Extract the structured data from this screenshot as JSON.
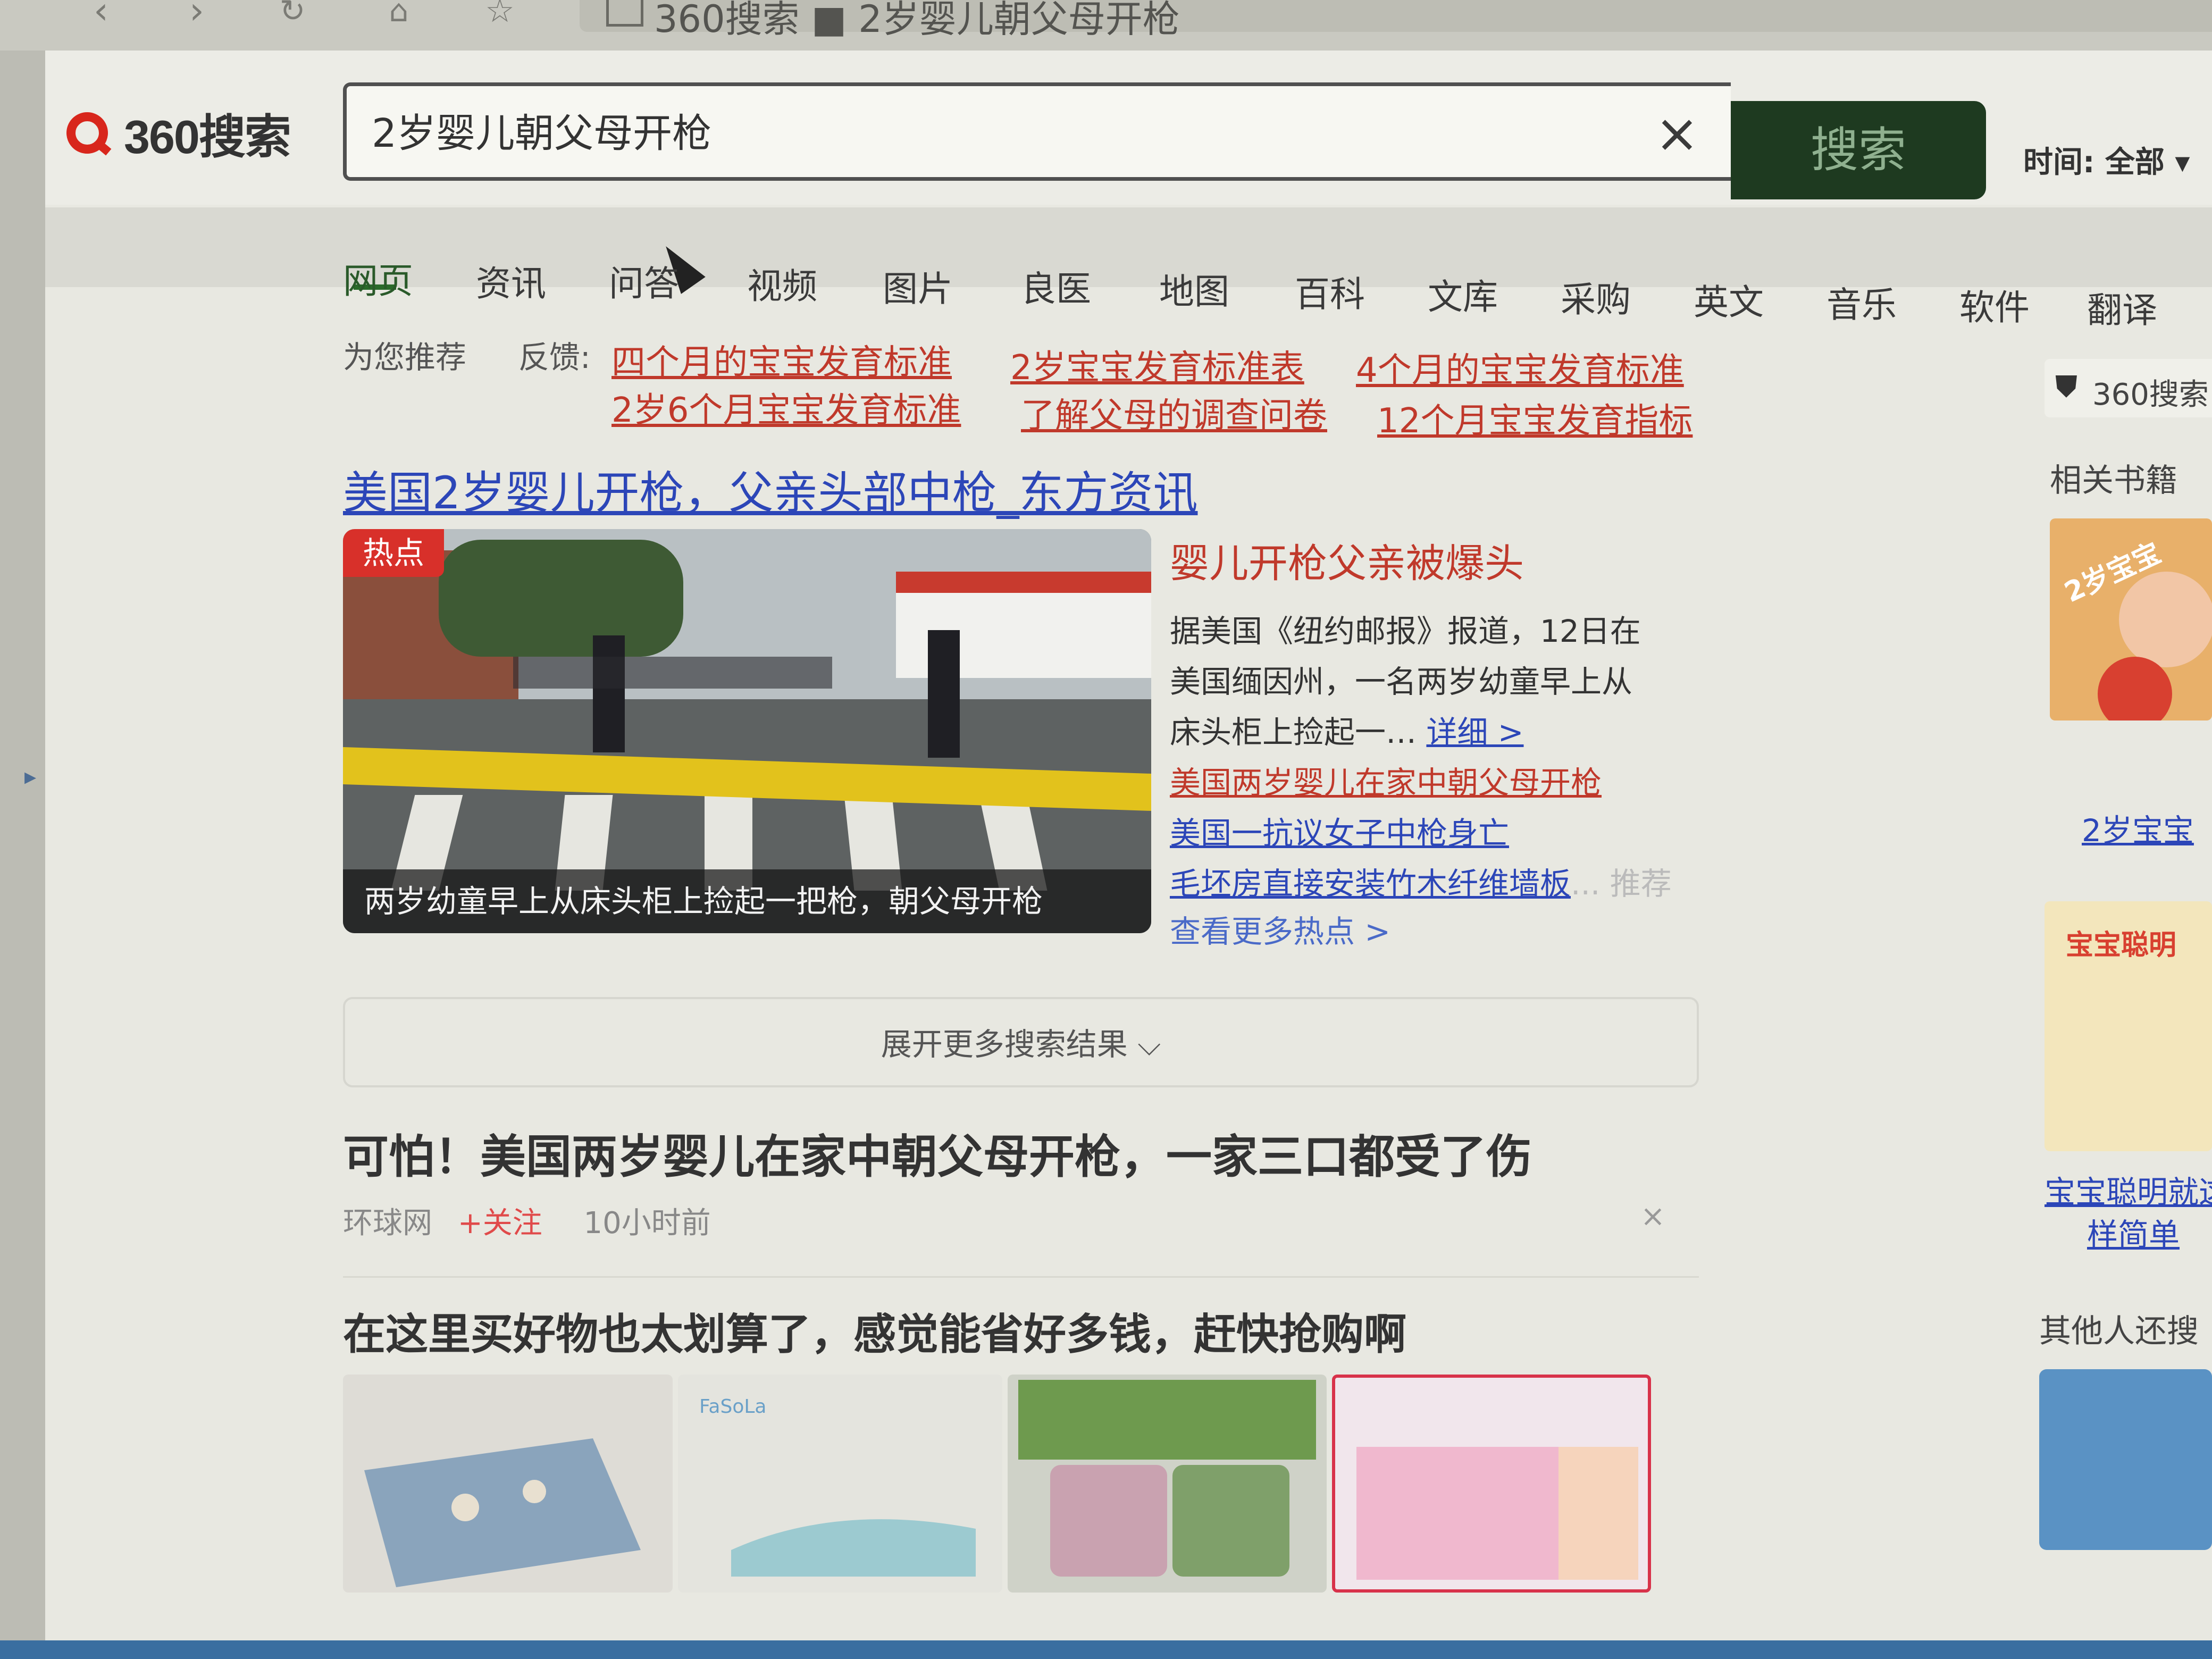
{
  "browser": {
    "tab_title": "360搜索 ■ 2岁婴儿朝父母开枪"
  },
  "header": {
    "logo_text": "360搜索",
    "search_value": "2岁婴儿朝父母开枪",
    "clear_label": "×",
    "search_button": "搜索",
    "time_filter": "时间: 全部 ▾"
  },
  "nav": {
    "tabs": [
      "网页",
      "资讯",
      "问答",
      "视频",
      "图片",
      "良医",
      "地图",
      "百科",
      "文库",
      "采购",
      "英文",
      "音乐",
      "软件",
      "翻译"
    ]
  },
  "recommend": {
    "label": "为您推荐",
    "feedback": "反馈:",
    "links": [
      "四个月的宝宝发育标准",
      "2岁宝宝发育标准表",
      "4个月的宝宝发育标准",
      "2岁6个月宝宝发育标准",
      "了解父母的调查问卷",
      "12个月宝宝发育指标"
    ]
  },
  "result1": {
    "title": "美国2岁婴儿开枪，父亲头部中枪_东方资讯",
    "badge": "热点",
    "caption": "两岁幼童早上从床头柜上捡起一把枪，朝父母开枪",
    "subtitle": "婴儿开枪父亲被爆头",
    "desc_lines": [
      "据美国《纽约邮报》报道，12日在",
      "美国缅因州，一名两岁幼童早上从",
      "床头柜上捡起一…"
    ],
    "detail_link": "详细 >",
    "related": [
      "美国两岁婴儿在家中朝父母开枪",
      "美国一抗议女子中枪身亡",
      "毛坯房直接安装竹木纤维墙板"
    ],
    "promo_tag": "... 推荐",
    "more_hot": "查看更多热点 >"
  },
  "expand_label": "展开更多搜索结果 ⌵",
  "result2": {
    "title": "可怕！美国两岁婴儿在家中朝父母开枪，一家三口都受了伤",
    "source": "环球网",
    "follow": "+关注",
    "time": "10小时前",
    "close": "×"
  },
  "result3": {
    "title": "在这里买好物也太划算了，感觉能省好多钱，赶快抢购啊",
    "product_brand": "FaSoLa"
  },
  "sidebar": {
    "badge": "360搜索",
    "related_books": "相关书籍",
    "book1_label": "2岁宝宝",
    "book1_cover": "2岁宝宝",
    "book2_label_1": "宝宝聪明就这",
    "book2_label_2": "样简单",
    "book2_cover": "宝宝聪明",
    "others": "其他人还搜"
  },
  "colors": {
    "link_blue": "#2c46b8",
    "link_red": "#c0392b",
    "search_button": "#1e3a20",
    "hot_badge": "#d8302a"
  }
}
